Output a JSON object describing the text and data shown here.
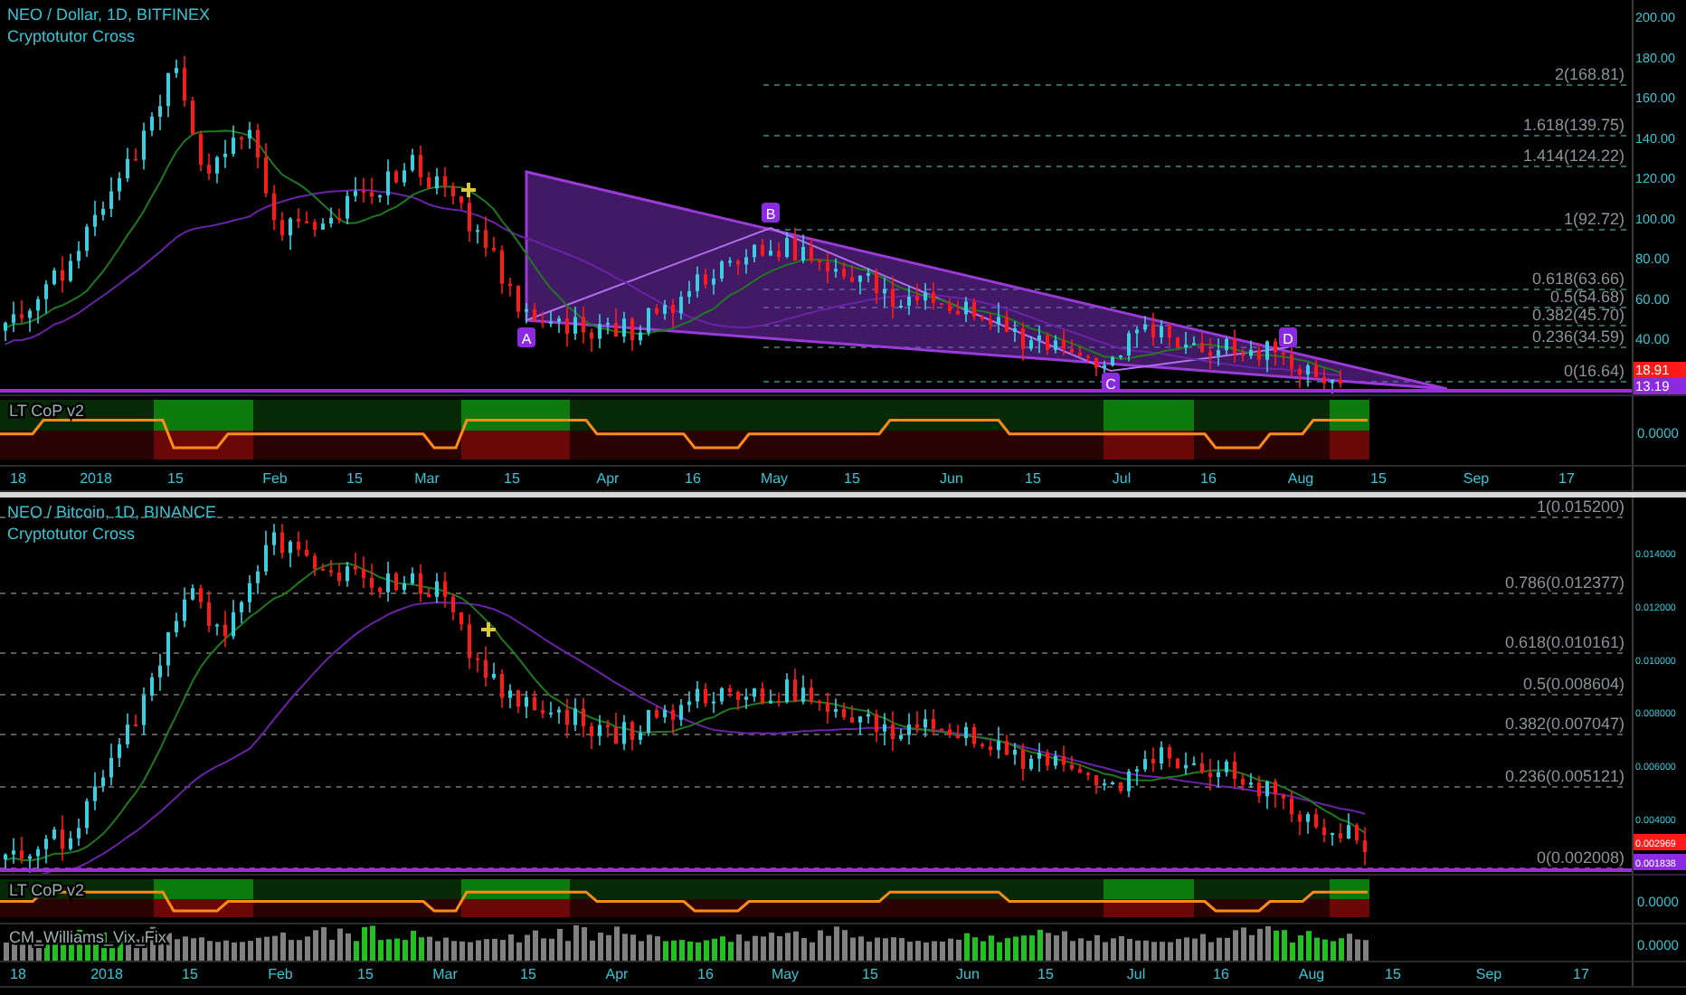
{
  "panes": [
    {
      "symbol": "NEO / Dollar, 1D, BITFINEX",
      "study": "Cryptotutor Cross",
      "kind": "usd",
      "price_axis": [
        "200.00",
        "180.00",
        "160.00",
        "140.00",
        "120.00",
        "100.00",
        "80.00",
        "60.00",
        "40.00"
      ],
      "fib_levels": [
        "2(168.81)",
        "1.618(139.75)",
        "1.414(124.22)",
        "1(92.72)",
        "0.618(63.66)",
        "0.5(54.68)",
        "0.382(45.70)",
        "0.236(34.59)",
        "0(16.64)"
      ],
      "price_tags": [
        {
          "text": "18.91",
          "kind": "last"
        },
        {
          "text": "13.19",
          "kind": "line"
        }
      ],
      "pattern_points": [
        "A",
        "B",
        "C",
        "D"
      ],
      "indicators": [
        {
          "kind": "cop",
          "label": "LT CoP v2",
          "axis": "0.0000"
        }
      ],
      "time_axis": [
        "18",
        "2018",
        "15",
        "Feb",
        "15",
        "Mar",
        "15",
        "Apr",
        "16",
        "May",
        "15",
        "Jun",
        "15",
        "Jul",
        "16",
        "Aug",
        "15",
        "Sep",
        "17"
      ]
    },
    {
      "symbol": "NEO / Bitcoin, 1D, BINANCE",
      "study": "Cryptotutor Cross",
      "kind": "btc",
      "price_axis": [
        "0.014000",
        "0.012000",
        "0.010000",
        "0.008000",
        "0.006000",
        "0.004000"
      ],
      "fib_levels": [
        "1(0.015200)",
        "0.786(0.012377)",
        "0.618(0.010161)",
        "0.5(0.008604)",
        "0.382(0.007047)",
        "0.236(0.005121)",
        "0(0.002008)"
      ],
      "price_tags": [
        {
          "text": "0.002969",
          "kind": "last"
        },
        {
          "text": "0.001838",
          "kind": "line"
        }
      ],
      "indicators": [
        {
          "kind": "cop",
          "label": "LT CoP v2",
          "axis": "0.0000"
        },
        {
          "kind": "vix",
          "label": "CM_Williams_Vix_Fix",
          "axis": "0.0000"
        }
      ],
      "time_axis": [
        "18",
        "2018",
        "15",
        "Feb",
        "15",
        "Mar",
        "15",
        "Apr",
        "16",
        "May",
        "15",
        "Jun",
        "15",
        "Jul",
        "16",
        "Aug",
        "15",
        "Sep",
        "17"
      ]
    }
  ]
}
